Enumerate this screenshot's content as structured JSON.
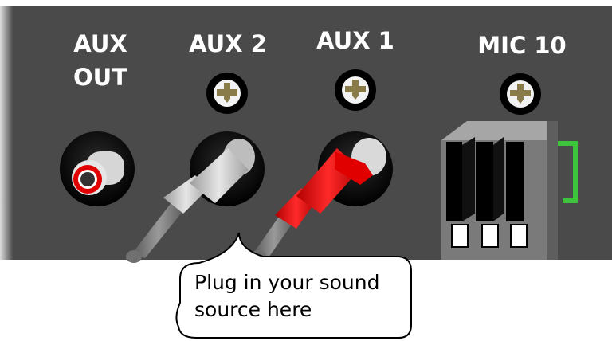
{
  "panel": {
    "colors": {
      "panel": "#4a4a4a",
      "bezel": "#6e6e6e",
      "screw": "#f2f2f2",
      "screw_mark": "#8a7b4a",
      "plug_red": "#e00000",
      "plug_grey": "#cfcfcf",
      "indicator": "#3ec33e"
    },
    "ports": [
      {
        "label_line1": "AUX",
        "label_line2": "OUT"
      },
      {
        "label_line1": "AUX 2"
      },
      {
        "label_line1": "AUX 1"
      },
      {
        "label_line1": "MIC 10"
      }
    ]
  },
  "callout": {
    "line1": "Plug in your sound",
    "line2": "source here"
  }
}
